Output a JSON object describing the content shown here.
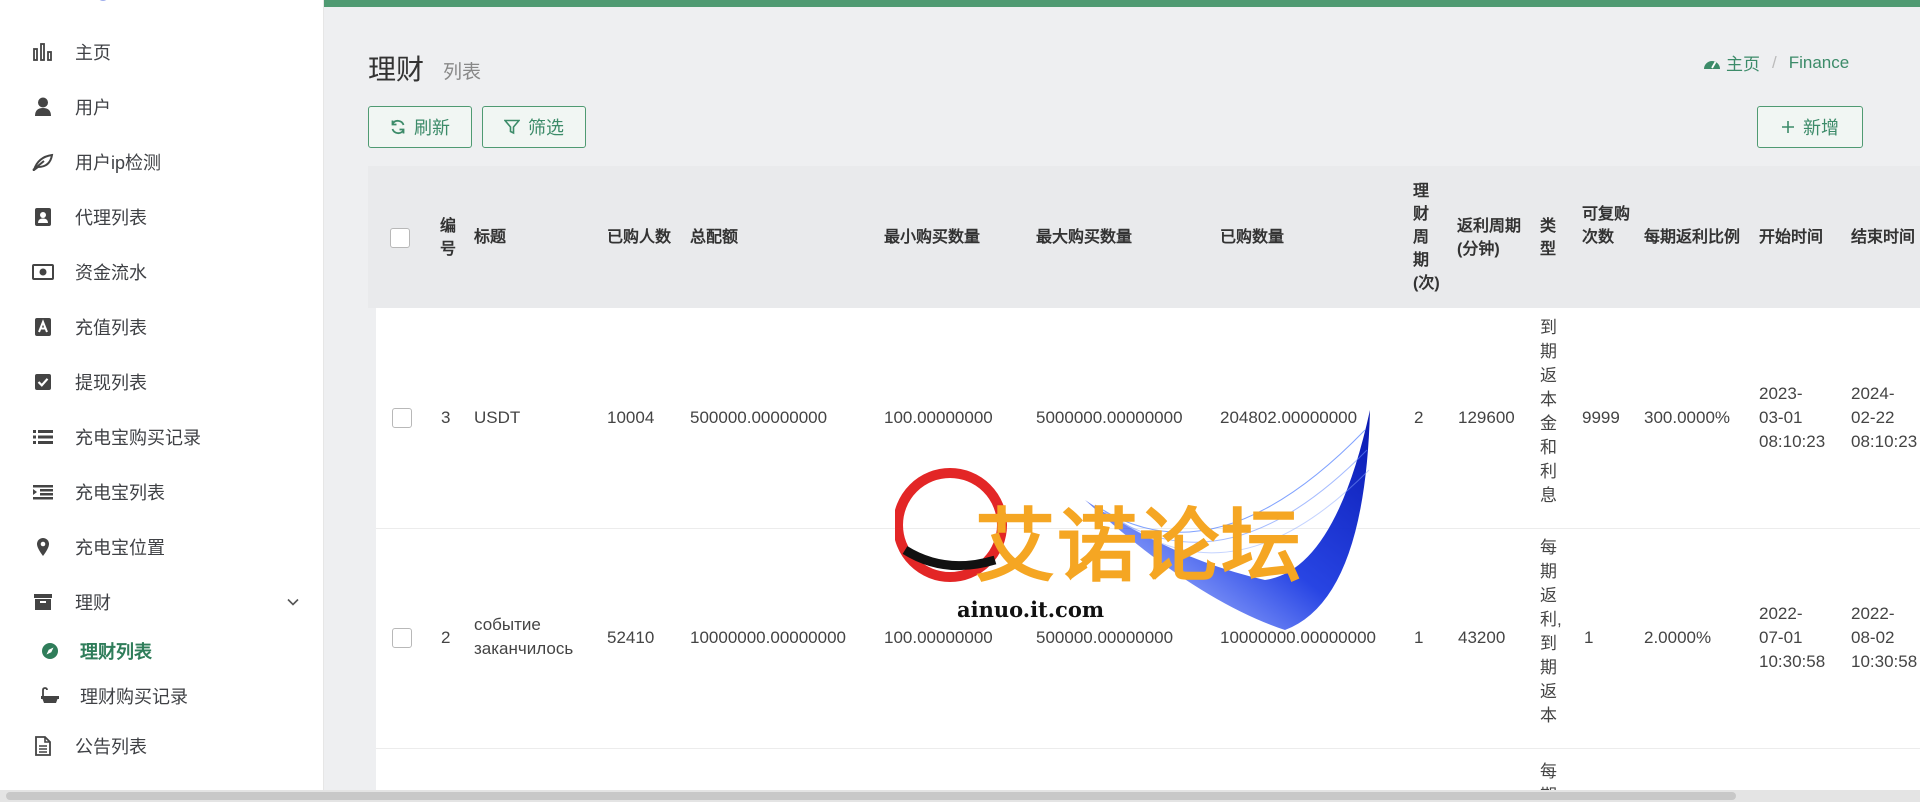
{
  "sidebar": {
    "items": [
      {
        "label": "主页",
        "icon": "bar-chart-icon"
      },
      {
        "label": "用户",
        "icon": "user-icon"
      },
      {
        "label": "用户ip检测",
        "icon": "leaf-icon"
      },
      {
        "label": "代理列表",
        "icon": "contact-card-icon"
      },
      {
        "label": "资金流水",
        "icon": "money-icon"
      },
      {
        "label": "充值列表",
        "icon": "letter-a-icon"
      },
      {
        "label": "提现列表",
        "icon": "check-square-icon"
      },
      {
        "label": "充电宝购买记录",
        "icon": "list-icon"
      },
      {
        "label": "充电宝列表",
        "icon": "indent-icon"
      },
      {
        "label": "充电宝位置",
        "icon": "map-marker-icon"
      },
      {
        "label": "理财",
        "icon": "archive-icon"
      },
      {
        "label": "公告列表",
        "icon": "file-text-icon"
      }
    ],
    "sub_items": [
      {
        "label": "理财列表",
        "icon": "compass-icon",
        "active": true
      },
      {
        "label": "理财购买记录",
        "icon": "bath-icon",
        "active": false
      }
    ]
  },
  "header": {
    "title": "理财",
    "subtitle": "列表",
    "breadcrumb": [
      "主页",
      "Finance"
    ],
    "accent_color": "#4f9a72"
  },
  "toolbar": {
    "refresh_label": "刷新",
    "filter_label": "筛选",
    "add_label": "新增"
  },
  "table": {
    "columns": [
      "编号",
      "标题",
      "已购人数",
      "总配额",
      "最小购买数量",
      "最大购买数量",
      "已购数量",
      "理财周期(次)",
      "返利周期(分钟)",
      "类型",
      "可复购次数",
      "每期返利比例",
      "开始时间",
      "结束时间"
    ],
    "rows": [
      {
        "id": "3",
        "title": "USDT",
        "buyers": "10004",
        "quota": "500000.00000000",
        "min": "100.00000000",
        "max": "5000000.00000000",
        "bought": "204802.00000000",
        "periods": "2",
        "cycle": "129600",
        "type": "到期返本金和利息",
        "repurchase": "9999",
        "ratio": "300.0000%",
        "start": [
          "2023-",
          "03-01",
          "08:10:23"
        ],
        "end": [
          "2024-",
          "02-22",
          "08:10:23"
        ]
      },
      {
        "id": "2",
        "title": "событие заканчилось",
        "buyers": "52410",
        "quota": "10000000.00000000",
        "min": "100.00000000",
        "max": "500000.00000000",
        "bought": "10000000.00000000",
        "periods": "1",
        "cycle": "43200",
        "type": "每期返利,到期返本",
        "repurchase": "1",
        "ratio": "2.0000%",
        "start": [
          "2022-",
          "07-01",
          "10:30:58"
        ],
        "end": [
          "2022-",
          "08-02",
          "10:30:58"
        ]
      },
      {
        "type": "每期"
      }
    ]
  },
  "watermark": {
    "text": "艾诺论坛",
    "url": "ainuo.it.com"
  }
}
